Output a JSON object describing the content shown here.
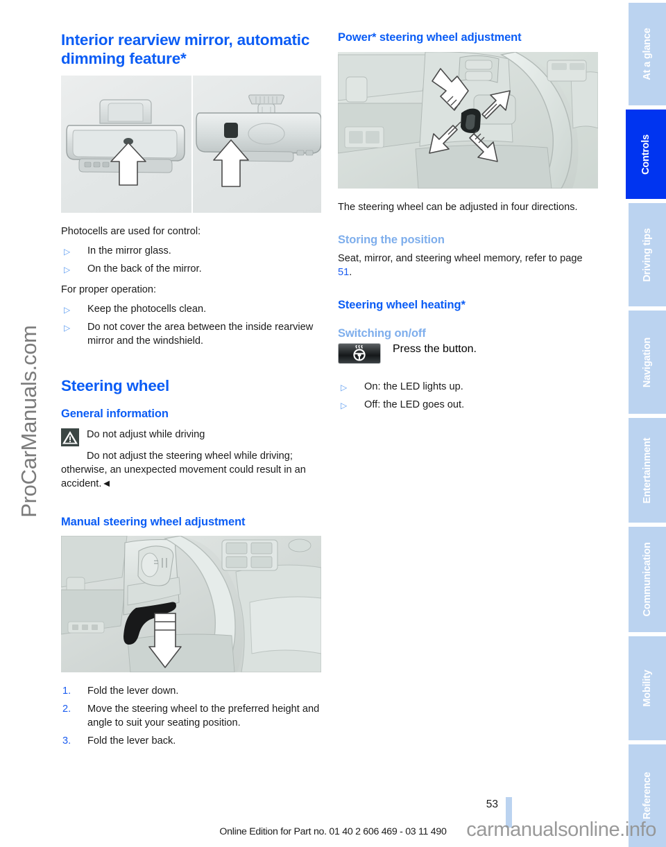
{
  "document": {
    "page_number": "53",
    "footer_text": "Online Edition for Part no. 01 40 2 606 469 - 03 11 490",
    "watermark_left": "ProCarManuals.com",
    "watermark_bottom": "carmanualsonline.info"
  },
  "colors": {
    "heading_blue": "#0a5cf5",
    "subhead_blue": "#7eaeec",
    "tab_inactive": "#bbd3f0",
    "tab_active": "#0034f0",
    "bullet_blue": "#5b9bf0",
    "body_text": "#1a1a1a"
  },
  "left_column": {
    "title": "Interior rearview mirror, automatic dimming feature*",
    "figure_mirrors_caption": "",
    "intro_1": "Photocells are used for control:",
    "bullets_1": [
      "In the mirror glass.",
      "On the back of the mirror."
    ],
    "intro_2": "For proper operation:",
    "bullets_2": [
      "Keep the photocells clean.",
      "Do not cover the area between the inside rearview mirror and the windshield."
    ],
    "section_title": "Steering wheel",
    "general_information_head": "General information",
    "warning_title": "Do not adjust while driving",
    "warning_body": "Do not adjust the steering wheel while driving; otherwise, an unexpected movement could result in an accident.◄",
    "manual_adjust_head": "Manual steering wheel adjustment",
    "steps": [
      {
        "num": "1.",
        "text": "Fold the lever down."
      },
      {
        "num": "2.",
        "text": "Move the steering wheel to the preferred height and angle to suit your seating position."
      },
      {
        "num": "3.",
        "text": "Fold the lever back."
      }
    ]
  },
  "right_column": {
    "power_head": "Power* steering wheel adjustment",
    "power_body": "The steering wheel can be adjusted in four directions.",
    "storing_head": "Storing the position",
    "storing_body_pre": "Seat, mirror, and steering wheel memory, refer to page ",
    "storing_body_link": "51",
    "storing_body_post": ".",
    "heating_head": "Steering wheel heating*",
    "switching_head": "Switching on/off",
    "press_button_text": "Press the button.",
    "led_bullets": [
      "On: the LED lights up.",
      "Off: the LED goes out."
    ]
  },
  "tabs": [
    {
      "label": "At a glance",
      "active": false
    },
    {
      "label": "Controls",
      "active": true
    },
    {
      "label": "Driving tips",
      "active": false
    },
    {
      "label": "Navigation",
      "active": false
    },
    {
      "label": "Entertainment",
      "active": false
    },
    {
      "label": "Communication",
      "active": false
    },
    {
      "label": "Mobility",
      "active": false
    },
    {
      "label": "Reference",
      "active": false
    }
  ]
}
